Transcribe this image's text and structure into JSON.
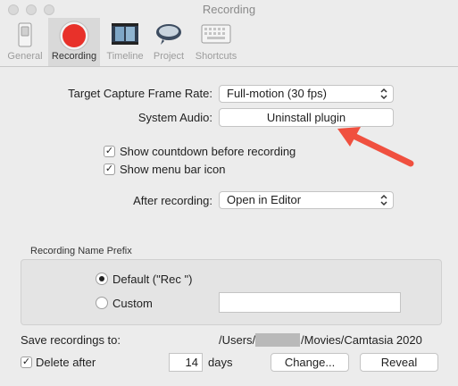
{
  "window": {
    "title": "Recording"
  },
  "toolbar": {
    "tabs": [
      {
        "label": "General",
        "icon": "switch-icon"
      },
      {
        "label": "Recording",
        "icon": "record-icon"
      },
      {
        "label": "Timeline",
        "icon": "filmstrip-icon"
      },
      {
        "label": "Project",
        "icon": "blimp-icon"
      },
      {
        "label": "Shortcuts",
        "icon": "keyboard-icon"
      }
    ],
    "active": "Recording"
  },
  "settings": {
    "frame_rate_label": "Target Capture Frame Rate:",
    "frame_rate_value": "Full-motion (30 fps)",
    "system_audio_label": "System Audio:",
    "system_audio_button": "Uninstall plugin",
    "countdown_label": "Show countdown before recording",
    "countdown_checked": true,
    "menubar_label": "Show menu bar icon",
    "menubar_checked": true,
    "after_recording_label": "After recording:",
    "after_recording_value": "Open in Editor"
  },
  "prefix": {
    "title": "Recording Name Prefix",
    "default_label": "Default (\"Rec \")",
    "custom_label": "Custom",
    "selected": "Default",
    "custom_value": ""
  },
  "save": {
    "label": "Save recordings to:",
    "path_prefix": "/Users/",
    "path_suffix": "/Movies/Camtasia 2020",
    "delete_label": "Delete after",
    "delete_checked": true,
    "days_value": "14",
    "days_unit": "days",
    "change_button": "Change...",
    "reveal_button": "Reveal"
  },
  "colors": {
    "record_red": "#e8312a",
    "arrow": "#f0503f"
  }
}
